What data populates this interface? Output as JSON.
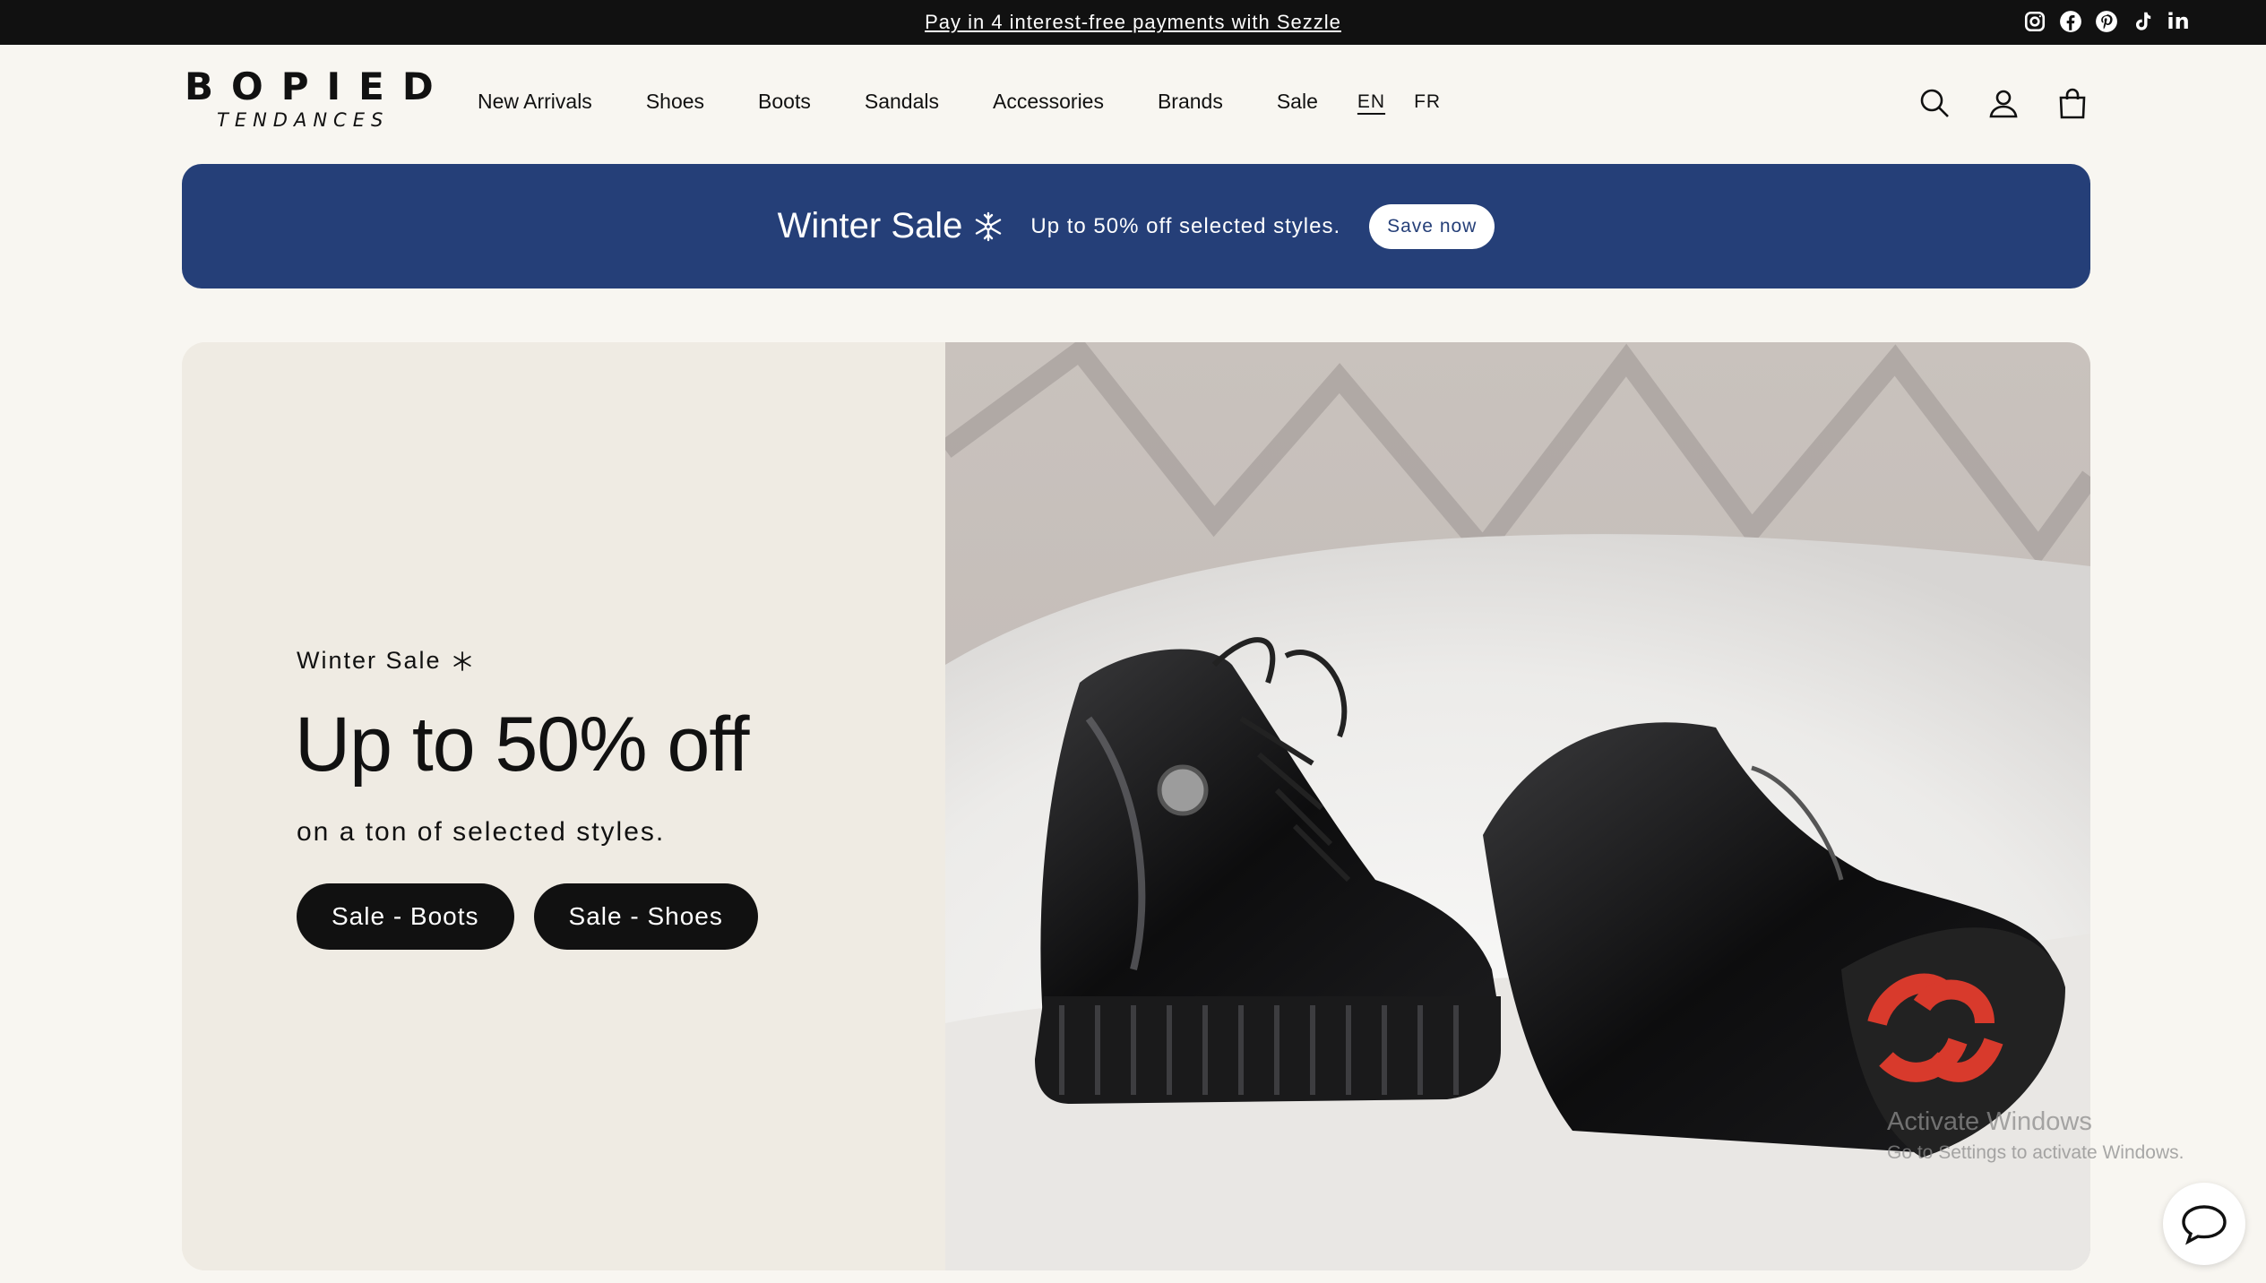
{
  "topbar": {
    "message": "Pay in 4 interest-free payments with Sezzle",
    "socials": [
      "instagram-icon",
      "facebook-icon",
      "pinterest-icon",
      "tiktok-icon",
      "linkedin-icon"
    ],
    "linkedin_text": "in"
  },
  "header": {
    "logo_main": "BOPIED",
    "logo_sub": "TENDANCES",
    "nav": [
      "New Arrivals",
      "Shoes",
      "Boots",
      "Sandals",
      "Accessories",
      "Brands",
      "Sale"
    ],
    "languages": [
      {
        "label": "EN",
        "active": true
      },
      {
        "label": "FR",
        "active": false
      }
    ],
    "icons": [
      "search-icon",
      "account-icon",
      "cart-icon"
    ]
  },
  "promo": {
    "title": "Winter Sale",
    "text": "Up to 50% off selected styles.",
    "button": "Save now",
    "background": "#253f78"
  },
  "hero": {
    "eyebrow": "Winter Sale",
    "headline": "Up to 50% off",
    "subtext": "on a ton of selected styles.",
    "buttons": [
      "Sale - Boots",
      "Sale - Shoes"
    ]
  },
  "watermark": {
    "title": "Activate Windows",
    "subtitle": "Go to Settings to activate Windows."
  },
  "colors": {
    "page_bg": "#f8f6f1",
    "topbar_bg": "#111111",
    "hero_left_bg": "#efebe3",
    "button_bg": "#111111",
    "accent_red": "#d83a2c"
  }
}
